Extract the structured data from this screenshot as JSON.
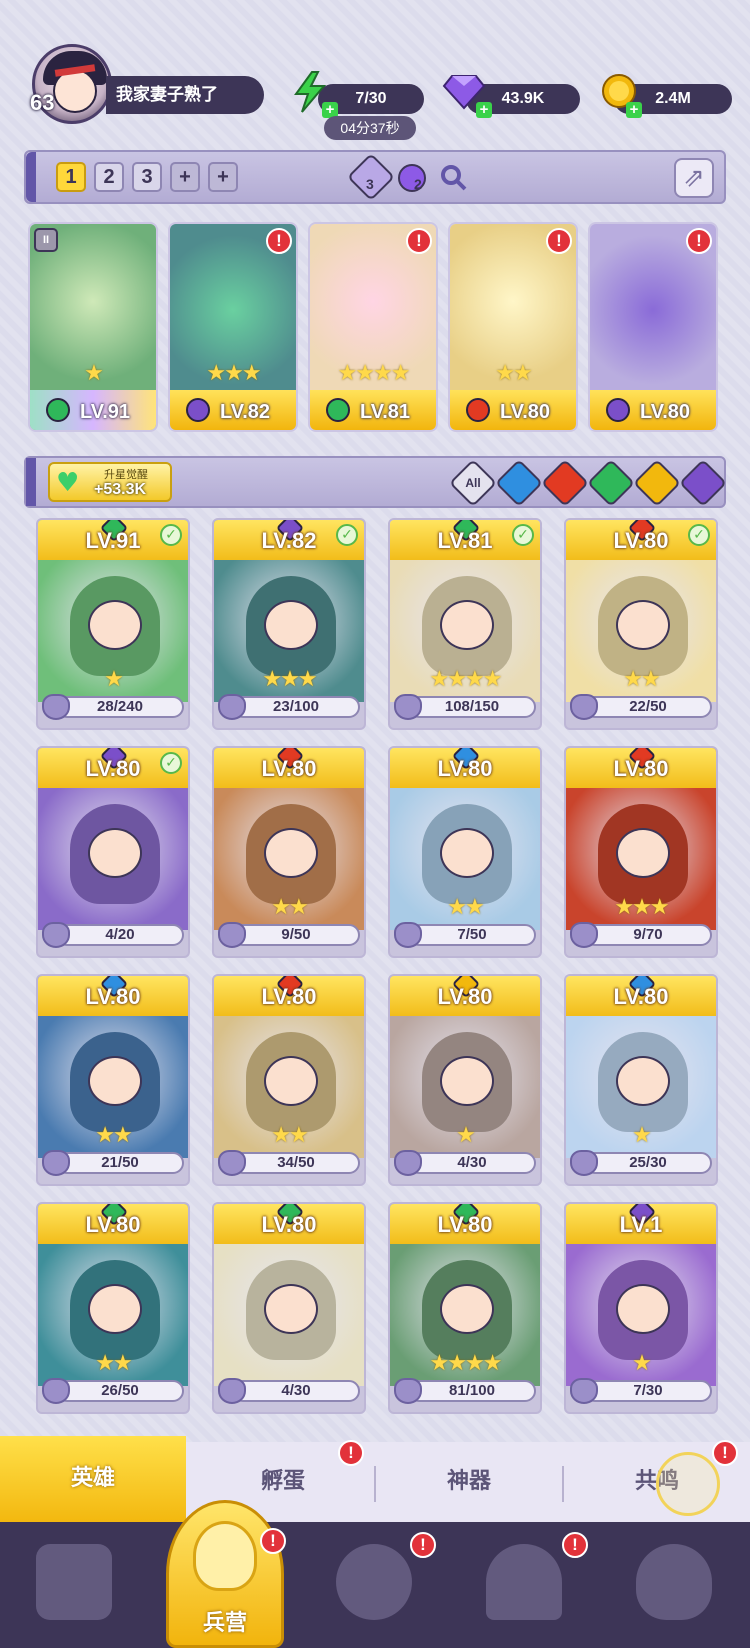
{
  "player": {
    "level": "63",
    "name": "我家妻子熟了"
  },
  "resources": {
    "energy": {
      "value": "7/30",
      "timer": "04分37秒",
      "icon": "lightning-icon",
      "color": "#3bd24a"
    },
    "gems": {
      "value": "43.9K",
      "icon": "purple-diamond-icon",
      "color": "#8d5ae6"
    },
    "gold": {
      "value": "2.4M",
      "icon": "gold-coin-icon",
      "color": "#f2b80d"
    }
  },
  "team_bar": {
    "tabs": [
      "1",
      "2",
      "3",
      "+",
      "+"
    ],
    "active_tab": "1",
    "element_counts": [
      {
        "icon": "water-gem-icon",
        "count": "3"
      },
      {
        "icon": "dark-gem-icon",
        "count": "2"
      }
    ],
    "search_icon": "magnifier-icon",
    "share_icon": "share-icon"
  },
  "lineup": [
    {
      "level": "LV.91",
      "element": "wind",
      "stars": "★",
      "badge": "",
      "locked": true
    },
    {
      "level": "LV.82",
      "element": "dark",
      "stars": "★★★",
      "badge": "!",
      "locked": false
    },
    {
      "level": "LV.81",
      "element": "wind",
      "stars": "★★★★",
      "badge": "!",
      "locked": false
    },
    {
      "level": "LV.80",
      "element": "fire",
      "stars": "★★",
      "badge": "!",
      "locked": false
    },
    {
      "level": "LV.80",
      "element": "dark",
      "stars": "",
      "badge": "!",
      "locked": false
    }
  ],
  "awaken": {
    "title": "升星觉醒",
    "value": "+53.3K"
  },
  "filters": [
    "All",
    "water",
    "fire",
    "wind",
    "light",
    "dark"
  ],
  "element_colors": {
    "water": "#2f8fe0",
    "fire": "#e23a22",
    "wind": "#2fb85a",
    "light": "#f2b80d",
    "dark": "#7b4fc9"
  },
  "heroes": [
    {
      "level": "LV.91",
      "element": "wind",
      "fragments": "28/240",
      "stars": "★",
      "checked": true,
      "art": "#6fbf7a"
    },
    {
      "level": "LV.82",
      "element": "dark",
      "fragments": "23/100",
      "stars": "★★★",
      "checked": true,
      "art": "#4f8c8e"
    },
    {
      "level": "LV.81",
      "element": "wind",
      "fragments": "108/150",
      "stars": "★★★★",
      "checked": true,
      "art": "#e9dcb6"
    },
    {
      "level": "LV.80",
      "element": "fire",
      "fragments": "22/50",
      "stars": "★★",
      "checked": true,
      "art": "#f0dfa6"
    },
    {
      "level": "LV.80",
      "element": "dark",
      "fragments": "4/20",
      "stars": "",
      "checked": true,
      "art": "#8a6bc9"
    },
    {
      "level": "LV.80",
      "element": "fire",
      "fragments": "9/50",
      "stars": "★★",
      "checked": false,
      "art": "#c98a5a"
    },
    {
      "level": "LV.80",
      "element": "water",
      "fragments": "7/50",
      "stars": "★★",
      "checked": false,
      "art": "#a9cbe6"
    },
    {
      "level": "LV.80",
      "element": "fire",
      "fragments": "9/70",
      "stars": "★★★",
      "checked": false,
      "art": "#c9442c"
    },
    {
      "level": "LV.80",
      "element": "water",
      "fragments": "21/50",
      "stars": "★★",
      "checked": false,
      "art": "#4a7bb0"
    },
    {
      "level": "LV.80",
      "element": "fire",
      "fragments": "34/50",
      "stars": "★★",
      "checked": false,
      "art": "#d8c089"
    },
    {
      "level": "LV.80",
      "element": "light",
      "fragments": "4/30",
      "stars": "★",
      "checked": false,
      "art": "#b9a6a0"
    },
    {
      "level": "LV.80",
      "element": "water",
      "fragments": "25/30",
      "stars": "★",
      "checked": false,
      "art": "#bcd4ef"
    },
    {
      "level": "LV.80",
      "element": "wind",
      "fragments": "26/50",
      "stars": "★★",
      "checked": false,
      "art": "#3f8f9a"
    },
    {
      "level": "LV.80",
      "element": "wind",
      "fragments": "4/30",
      "stars": "",
      "checked": false,
      "art": "#e6e0c4"
    },
    {
      "level": "LV.80",
      "element": "wind",
      "fragments": "81/100",
      "stars": "★★★★",
      "checked": false,
      "art": "#6a9e74"
    },
    {
      "level": "LV.1",
      "element": "dark",
      "fragments": "7/30",
      "stars": "★",
      "checked": false,
      "art": "#9a6bd0"
    }
  ],
  "subtabs": [
    {
      "label": "英雄",
      "active": true,
      "badge": false
    },
    {
      "label": "孵蛋",
      "active": false,
      "badge": true
    },
    {
      "label": "神器",
      "active": false,
      "badge": false
    },
    {
      "label": "共鸣",
      "active": false,
      "badge": true
    }
  ],
  "nav": [
    {
      "icon": "cards-icon",
      "label": "",
      "badge": false
    },
    {
      "icon": "barracks-icon",
      "label": "兵营",
      "badge": true,
      "active": true
    },
    {
      "icon": "book-icon",
      "label": "",
      "badge": true
    },
    {
      "icon": "castle-icon",
      "label": "",
      "badge": true
    },
    {
      "icon": "guild-icon",
      "label": "",
      "badge": false
    }
  ]
}
